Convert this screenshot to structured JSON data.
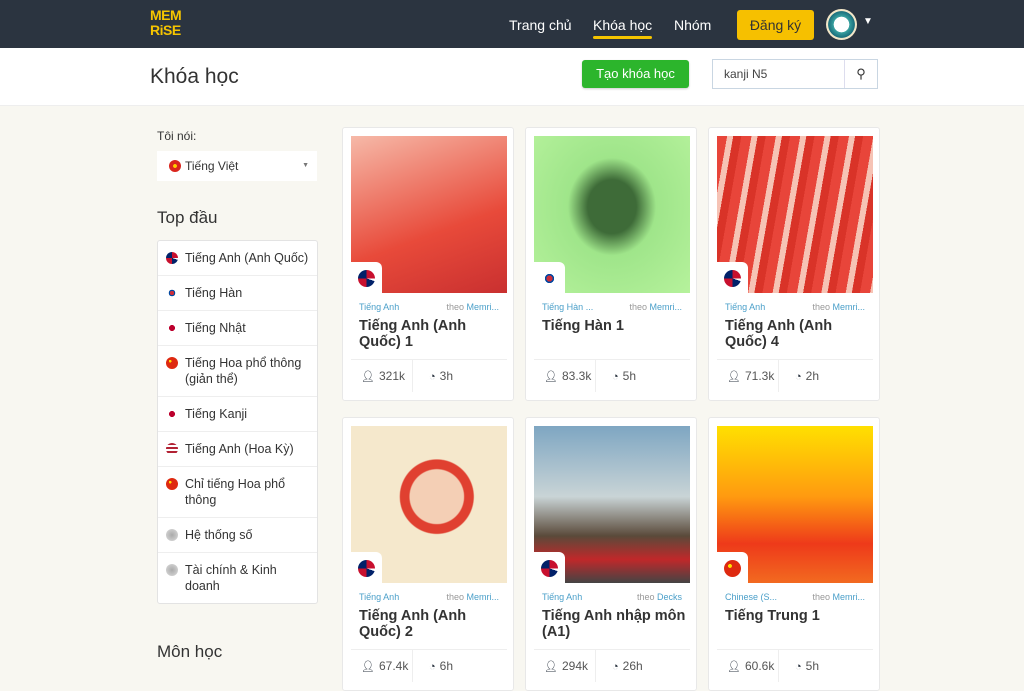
{
  "nav": {
    "logo": "MEM RISE",
    "links": [
      "Trang chủ",
      "Khóa học",
      "Nhóm"
    ],
    "signup": "Đăng ký"
  },
  "header": {
    "title": "Khóa học",
    "create": "Tạo khóa học",
    "search_value": "kanji N5"
  },
  "sidebar": {
    "speak_label": "Tôi nói:",
    "language": "Tiếng Việt",
    "top_title": "Top đầu",
    "subjects_title": "Môn học",
    "items": [
      {
        "label": "Tiếng Anh (Anh Quốc)",
        "flag": "gb"
      },
      {
        "label": "Tiếng Hàn",
        "flag": "kr"
      },
      {
        "label": "Tiếng Nhật",
        "flag": "jp"
      },
      {
        "label": "Tiếng Hoa phổ thông (giản thể)",
        "flag": "cn"
      },
      {
        "label": "Tiếng Kanji",
        "flag": "jp"
      },
      {
        "label": "Tiếng Anh (Hoa Kỳ)",
        "flag": "us"
      },
      {
        "label": "Chỉ tiếng Hoa phổ thông",
        "flag": "cn"
      },
      {
        "label": "Hệ thống số",
        "flag": "gr"
      },
      {
        "label": "Tài chính & Kinh doanh",
        "flag": "gr"
      }
    ]
  },
  "courses": [
    {
      "category": "Tiếng Anh",
      "by": "theo",
      "author": "Memri...",
      "title": "Tiếng Anh (Anh Quốc) 1",
      "learners": "321k",
      "time": "3h",
      "flag": "gb",
      "img": "linear-gradient(160deg,#f6b9a8,#e84a3a 60%,#c93030)"
    },
    {
      "category": "Tiếng Hàn ...",
      "by": "theo",
      "author": "Memri...",
      "title": "Tiếng Hàn 1",
      "learners": "83.3k",
      "time": "5h",
      "flag": "kr",
      "img": "radial-gradient(ellipse at 50% 45%,#3e6b38 0 22%,#9fe58a 40%,#b6f29c)"
    },
    {
      "category": "Tiếng Anh",
      "by": "theo",
      "author": "Memri...",
      "title": "Tiếng Anh (Anh Quốc) 4",
      "learners": "71.3k",
      "time": "2h",
      "flag": "gb",
      "img": "repeating-linear-gradient(100deg,#e8453a 0 10px,#f6c3b5 10px 16px,#d93328 16px 24px)"
    },
    {
      "category": "Tiếng Anh",
      "by": "theo",
      "author": "Memri...",
      "title": "Tiếng Anh (Anh Quốc) 2",
      "learners": "67.4k",
      "time": "6h",
      "flag": "gb",
      "img": "radial-gradient(ellipse at 55% 45%,#f4cfb5 0 22%,#e04030 23% 30%,#f5e8cc 31%)"
    },
    {
      "category": "Tiếng Anh",
      "by": "theo",
      "author": "Decks",
      "title": "Tiếng Anh nhập môn (A1)",
      "learners": "294k",
      "time": "26h",
      "flag": "gb",
      "img": "linear-gradient(180deg,#7ea6c2,#c9d4d6 45%,#5a4a3a 70%,#c0282a 85%,#444)"
    },
    {
      "category": "Chinese (S...",
      "by": "theo",
      "author": "Memri...",
      "title": "Tiếng Trung 1",
      "learners": "60.6k",
      "time": "5h",
      "flag": "cn",
      "img": "linear-gradient(180deg,#ffe000,#ff9a10 45%,#ee3a1a 75%,#f26a20)"
    }
  ]
}
